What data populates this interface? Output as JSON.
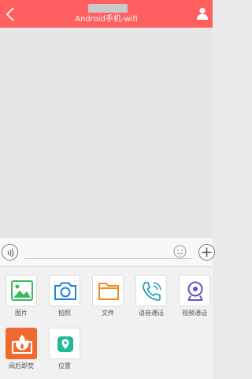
{
  "header": {
    "subtitle": "Android手机-wifi",
    "color": "#ff5f5f"
  },
  "composer": {
    "message_value": "",
    "icons": [
      "voice-icon",
      "emoji-icon",
      "plus-icon"
    ]
  },
  "actions": [
    {
      "label": "图片",
      "icon": "image-icon",
      "color": "#3cb95a"
    },
    {
      "label": "拍照",
      "icon": "camera-icon",
      "color": "#1e7ee0"
    },
    {
      "label": "文件",
      "icon": "folder-icon",
      "color": "#f08c19"
    },
    {
      "label": "语音通话",
      "icon": "phone-call-icon",
      "color": "#2aa2b8"
    },
    {
      "label": "视频通话",
      "icon": "webcam-icon",
      "color": "#6b50c8"
    },
    {
      "label": "阅后即焚",
      "icon": "fire-icon",
      "color": "#f06a30"
    },
    {
      "label": "位置",
      "icon": "location-icon",
      "color": "#22b89a"
    }
  ]
}
